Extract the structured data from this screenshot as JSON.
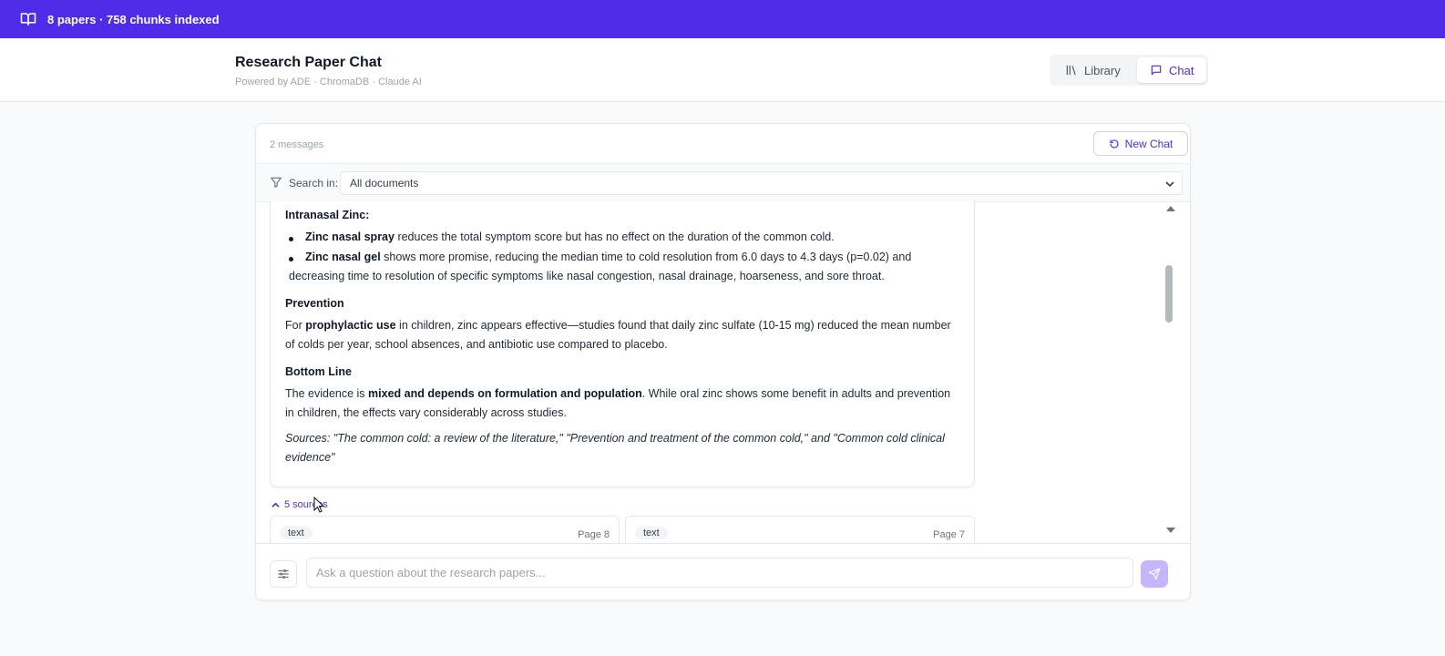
{
  "topbar": {
    "status": "8 papers · 758 chunks indexed",
    "icon": "book-icon"
  },
  "header": {
    "title": "Research Paper Chat",
    "subtitle": "Powered by ADE · ChromaDB · Claude AI",
    "nav": {
      "library_label": "Library",
      "chat_label": "Chat",
      "active": "Chat"
    }
  },
  "chat": {
    "message_count": "2 messages",
    "new_chat_label": "New Chat",
    "filter": {
      "label": "Search in:",
      "selected": "All documents"
    },
    "answer": {
      "intranasal_heading": "Intranasal Zinc:",
      "bullets": [
        {
          "bold": "Zinc nasal spray",
          "text": " reduces the total symptom score but has no effect on the duration of the common cold."
        },
        {
          "bold": "Zinc nasal gel",
          "text": " shows more promise, reducing the median time to cold resolution from 6.0 days to 4.3 days (p=0.02) and",
          "text2": "decreasing time to resolution of specific symptoms like nasal congestion, nasal drainage, hoarseness, and sore throat."
        }
      ],
      "prevention_heading": "Prevention",
      "prevention": {
        "pre": "For ",
        "bold": "prophylactic use",
        "post": " in children, zinc appears effective—studies found that daily zinc sulfate (10-15 mg) reduced the mean number",
        "line2": "of colds per year, school absences, and antibiotic use compared to placebo."
      },
      "bottom_heading": "Bottom Line",
      "bottom": {
        "pre": "The evidence is ",
        "bold": "mixed and depends on formulation and population",
        "post": ". While oral zinc shows some benefit in adults and prevention",
        "line2": "in children, the effects vary considerably across studies."
      },
      "sources_line1": "Sources: \"The common cold: a review of the literature,\" \"Prevention and treatment of the common cold,\" and \"Common cold clinical",
      "sources_line2": "evidence\""
    },
    "sources_toggle": "5 sources",
    "source_cards": [
      {
        "tag": "text",
        "page": "Page 8"
      },
      {
        "tag": "text",
        "page": "Page 7"
      }
    ],
    "input_placeholder": "Ask a question about the research papers..."
  },
  "colors": {
    "brand": "#4f2de8",
    "send_disabled": "#c4b5fd"
  }
}
